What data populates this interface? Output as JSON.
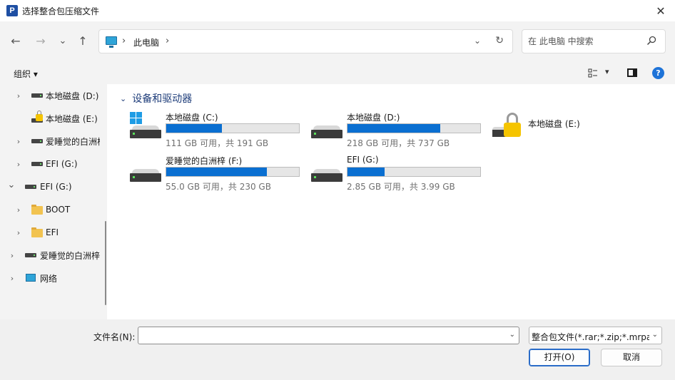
{
  "window": {
    "title": "选择整合包压缩文件",
    "app_icon_letter": "P",
    "close_glyph": "✕"
  },
  "nav": {
    "back_glyph": "←",
    "forward_glyph": "→",
    "recent_glyph": "⌄",
    "up_glyph": "↑",
    "address_sep": "›",
    "address_location": "此电脑",
    "address_dropdown_glyph": "⌄",
    "refresh_glyph": "↻",
    "search_placeholder": "在 此电脑 中搜索"
  },
  "commandbar": {
    "organize_label": "组织 ▾",
    "view_arrow": "▾",
    "help_glyph": "?"
  },
  "tree": {
    "chev_right": "›",
    "chev_down": "⌄",
    "items": [
      {
        "label": "本地磁盘 (D:)"
      },
      {
        "label": "本地磁盘 (E:)"
      },
      {
        "label": "爱睡觉的白洲梓"
      },
      {
        "label": "EFI (G:)"
      },
      {
        "label": "EFI (G:)"
      },
      {
        "label": "BOOT"
      },
      {
        "label": "EFI"
      },
      {
        "label": "爱睡觉的白洲梓"
      },
      {
        "label": "网络"
      }
    ]
  },
  "main": {
    "group_chev": "⌄",
    "group_title": "设备和驱动器",
    "drives": [
      {
        "name": "本地磁盘 (C:)",
        "free_text": "111 GB 可用，共 191 GB",
        "used_fraction": 0.42
      },
      {
        "name": "本地磁盘 (D:)",
        "free_text": "218 GB 可用，共 737 GB",
        "used_fraction": 0.7
      },
      {
        "name": "爱睡觉的白洲梓 (F:)",
        "free_text": "55.0 GB 可用，共 230 GB",
        "used_fraction": 0.76
      },
      {
        "name": "EFI (G:)",
        "free_text": "2.85 GB 可用，共 3.99 GB",
        "used_fraction": 0.28
      }
    ],
    "locked_drive": {
      "name": "本地磁盘 (E:)"
    }
  },
  "bottom": {
    "filename_label": "文件名(N):",
    "filename_value": "",
    "dropdown_glyph": "⌄",
    "filter_text": "整合包文件(*.rar;*.zip;*.mrpack)",
    "open_label": "打开(O)",
    "cancel_label": "取消"
  },
  "colors": {
    "accent": "#0a6fd1",
    "group_title": "#1e3d7a",
    "lock": "#f5c400"
  }
}
